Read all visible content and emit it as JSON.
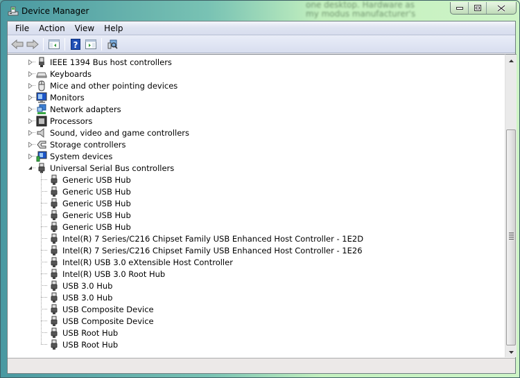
{
  "window": {
    "title": "Device Manager",
    "caption_buttons": {
      "minimize": "minimize",
      "maximize": "maximize",
      "close": "close"
    }
  },
  "background_text": [
    "one desktop. Hardware as",
    "my modus manufacturer's"
  ],
  "menu": [
    "File",
    "Action",
    "View",
    "Help"
  ],
  "toolbar": [
    {
      "name": "back-button",
      "icon": "back-arrow-icon"
    },
    {
      "name": "forward-button",
      "icon": "forward-arrow-icon"
    },
    {
      "name": "show-hide-console-tree-button",
      "icon": "console-tree-icon"
    },
    {
      "name": "help-button",
      "icon": "help-icon"
    },
    {
      "name": "show-hide-action-pane-button",
      "icon": "action-pane-icon"
    },
    {
      "name": "scan-hardware-changes-button",
      "icon": "scan-hardware-icon"
    }
  ],
  "tree": {
    "categories": [
      {
        "label": "IEEE 1394 Bus host controllers",
        "icon": "firewire-icon",
        "expanded": false
      },
      {
        "label": "Keyboards",
        "icon": "keyboard-icon",
        "expanded": false
      },
      {
        "label": "Mice and other pointing devices",
        "icon": "mouse-icon",
        "expanded": false
      },
      {
        "label": "Monitors",
        "icon": "monitor-icon",
        "expanded": false
      },
      {
        "label": "Network adapters",
        "icon": "network-adapter-icon",
        "expanded": false
      },
      {
        "label": "Processors",
        "icon": "processor-icon",
        "expanded": false
      },
      {
        "label": "Sound, video and game controllers",
        "icon": "speaker-icon",
        "expanded": false
      },
      {
        "label": "Storage controllers",
        "icon": "storage-controller-icon",
        "expanded": false
      },
      {
        "label": "System devices",
        "icon": "system-device-icon",
        "expanded": false
      },
      {
        "label": "Universal Serial Bus controllers",
        "icon": "usb-icon",
        "expanded": true
      }
    ],
    "usb_children": [
      "Generic USB Hub",
      "Generic USB Hub",
      "Generic USB Hub",
      "Generic USB Hub",
      "Generic USB Hub",
      "Intel(R) 7 Series/C216 Chipset Family USB Enhanced Host Controller - 1E2D",
      "Intel(R) 7 Series/C216 Chipset Family USB Enhanced Host Controller - 1E26",
      "Intel(R) USB 3.0 eXtensible Host Controller",
      "Intel(R) USB 3.0 Root Hub",
      "USB 3.0 Hub",
      "USB 3.0 Hub",
      "USB Composite Device",
      "USB Composite Device",
      "USB Root Hub",
      "USB Root Hub"
    ]
  },
  "scrollbar": {
    "position_fraction": 1.0
  },
  "statusbar": {
    "text": ""
  }
}
